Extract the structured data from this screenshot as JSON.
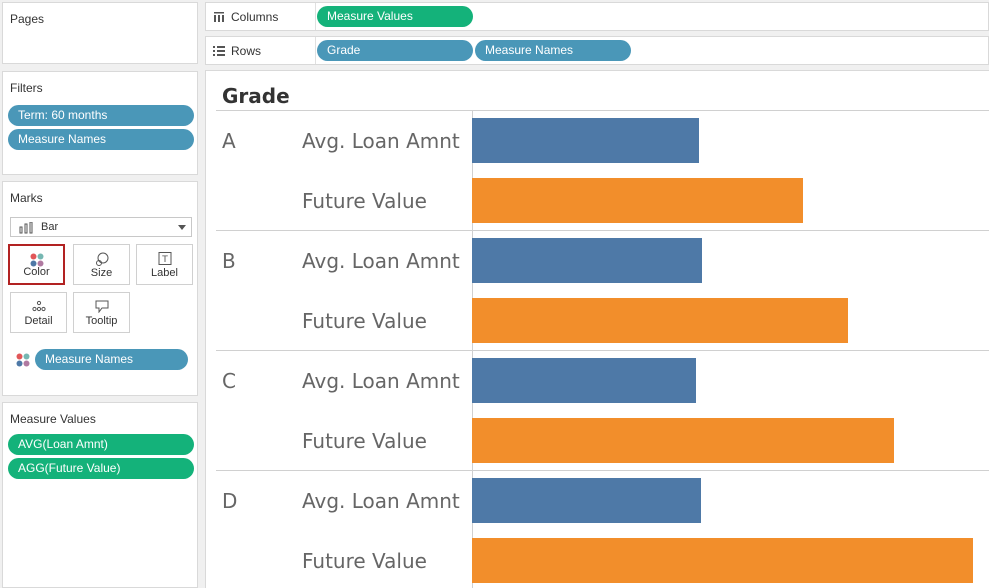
{
  "pages": {
    "title": "Pages"
  },
  "filters": {
    "title": "Filters",
    "pills": [
      "Term: 60 months",
      "Measure Names"
    ]
  },
  "marks": {
    "title": "Marks",
    "type": "Bar",
    "buttons": {
      "color": "Color",
      "size": "Size",
      "label": "Label",
      "detail": "Detail",
      "tooltip": "Tooltip"
    },
    "color_pill": "Measure Names"
  },
  "measure_values": {
    "title": "Measure Values",
    "pills": [
      "AVG(Loan Amnt)",
      "AGG(Future Value)"
    ]
  },
  "columns": {
    "label": "Columns",
    "pill": "Measure Values"
  },
  "rows": {
    "label": "Rows",
    "pills": [
      "Grade",
      "Measure Names"
    ]
  },
  "view": {
    "header": "Grade"
  },
  "colors": {
    "avg_loan": "#4e79a7",
    "future_value": "#f28e2b"
  },
  "chart_data": {
    "type": "bar",
    "orientation": "horizontal",
    "categories": [
      "A",
      "B",
      "C",
      "D"
    ],
    "row_header": "Grade",
    "series": [
      {
        "name": "Avg. Loan Amnt",
        "values": [
          227,
          230,
          224,
          229
        ]
      },
      {
        "name": "Future Value",
        "values": [
          330,
          375,
          421,
          500
        ]
      }
    ],
    "xlim": [
      0,
      517
    ],
    "grid": false,
    "units": "relative (no axis shown)"
  }
}
